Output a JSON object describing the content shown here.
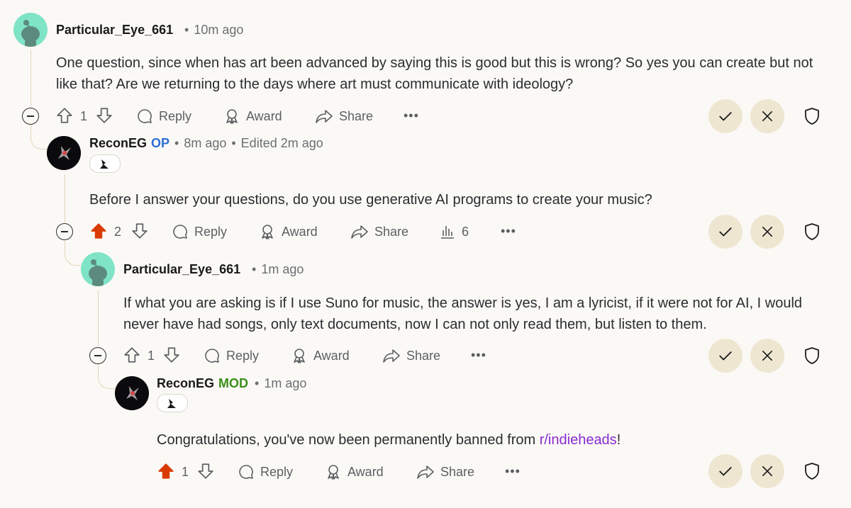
{
  "comments": [
    {
      "author": "Particular_Eye_661",
      "time": "10m ago",
      "body": "One question, since when has art been advanced by saying this is good but this is wrong? So yes you can create but not like that? Are we returning to the days where art must communicate with ideology?",
      "votes": "1",
      "actions": {
        "reply": "Reply",
        "award": "Award",
        "share": "Share",
        "more": "•••"
      }
    },
    {
      "author": "ReconEG",
      "tag": "OP",
      "time": "8m ago",
      "edited": "Edited 2m ago",
      "body": "Before I answer your questions, do you use generative AI programs to create your music?",
      "votes": "2",
      "upvoted": true,
      "insights": "6",
      "actions": {
        "reply": "Reply",
        "award": "Award",
        "share": "Share",
        "more": "•••"
      }
    },
    {
      "author": "Particular_Eye_661",
      "time": "1m ago",
      "body": "If what you are asking is if I use Suno for music, the answer is yes, I am a lyricist, if it were not for AI, I would never have had songs, only text documents, now I can not only read them, but listen to them.",
      "votes": "1",
      "actions": {
        "reply": "Reply",
        "award": "Award",
        "share": "Share",
        "more": "•••"
      }
    },
    {
      "author": "ReconEG",
      "tag": "MOD",
      "time": "1m ago",
      "body_prefix": "Congratulations, you've now been permanently banned from ",
      "body_link": "r/indieheads",
      "body_suffix": "!",
      "votes": "1",
      "upvoted": true,
      "actions": {
        "reply": "Reply",
        "award": "Award",
        "share": "Share",
        "more": "•••"
      }
    }
  ],
  "colors": {
    "background": "#fbf9f5",
    "upvote_active": "#d93a00",
    "op_tag": "#2d6ed6",
    "mod_tag": "#3a8f1a",
    "subreddit_link": "#8a2bd2",
    "mod_button_bg": "#efe6d2"
  }
}
